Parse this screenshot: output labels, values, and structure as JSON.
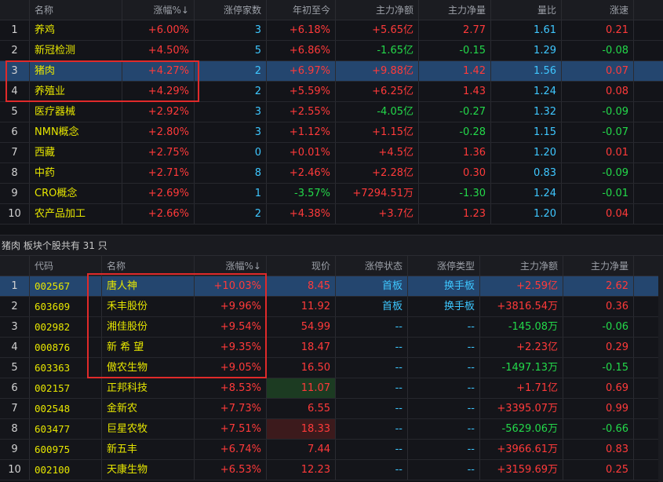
{
  "sectors": {
    "columns": [
      "",
      "名称",
      "涨幅%↓",
      "涨停家数",
      "年初至今",
      "主力净额",
      "主力净量",
      "量比",
      "涨速"
    ],
    "selected_index": 2,
    "rows": [
      {
        "idx": "1",
        "name": "养鸡",
        "change": "+6.00%",
        "limit_up": "3",
        "ytd": "+6.18%",
        "net_amount": "+5.65亿",
        "net_volume": "2.77",
        "vol_ratio": "1.61",
        "speed": "0.21"
      },
      {
        "idx": "2",
        "name": "新冠检测",
        "change": "+4.50%",
        "limit_up": "5",
        "ytd": "+6.86%",
        "net_amount": "-1.65亿",
        "net_volume": "-0.15",
        "vol_ratio": "1.29",
        "speed": "-0.08"
      },
      {
        "idx": "3",
        "name": "猪肉",
        "change": "+4.27%",
        "limit_up": "2",
        "ytd": "+6.97%",
        "net_amount": "+9.88亿",
        "net_volume": "1.42",
        "vol_ratio": "1.56",
        "speed": "0.07"
      },
      {
        "idx": "4",
        "name": "养殖业",
        "change": "+4.29%",
        "limit_up": "2",
        "ytd": "+5.59%",
        "net_amount": "+6.25亿",
        "net_volume": "1.43",
        "vol_ratio": "1.24",
        "speed": "0.08"
      },
      {
        "idx": "5",
        "name": "医疗器械",
        "change": "+2.92%",
        "limit_up": "3",
        "ytd": "+2.55%",
        "net_amount": "-4.05亿",
        "net_volume": "-0.27",
        "vol_ratio": "1.32",
        "speed": "-0.09"
      },
      {
        "idx": "6",
        "name": "NMN概念",
        "change": "+2.80%",
        "limit_up": "3",
        "ytd": "+1.12%",
        "net_amount": "+1.15亿",
        "net_volume": "-0.28",
        "vol_ratio": "1.15",
        "speed": "-0.07"
      },
      {
        "idx": "7",
        "name": "西藏",
        "change": "+2.75%",
        "limit_up": "0",
        "ytd": "+0.01%",
        "net_amount": "+4.5亿",
        "net_volume": "1.36",
        "vol_ratio": "1.20",
        "speed": "0.01"
      },
      {
        "idx": "8",
        "name": "中药",
        "change": "+2.71%",
        "limit_up": "8",
        "ytd": "+2.46%",
        "net_amount": "+2.28亿",
        "net_volume": "0.30",
        "vol_ratio": "0.83",
        "speed": "-0.09"
      },
      {
        "idx": "9",
        "name": "CRO概念",
        "change": "+2.69%",
        "limit_up": "1",
        "ytd": "-3.57%",
        "net_amount": "+7294.51万",
        "net_volume": "-1.30",
        "vol_ratio": "1.24",
        "speed": "-0.01"
      },
      {
        "idx": "10",
        "name": "农产品加工",
        "change": "+2.66%",
        "limit_up": "2",
        "ytd": "+4.38%",
        "net_amount": "+3.7亿",
        "net_volume": "1.23",
        "vol_ratio": "1.20",
        "speed": "0.04"
      }
    ]
  },
  "info_bar": {
    "text": "猪肉  板块个股共有 31 只"
  },
  "stocks": {
    "columns": [
      "",
      "代码",
      "名称",
      "涨幅%↓",
      "现价",
      "涨停状态",
      "涨停类型",
      "主力净额",
      "主力净量"
    ],
    "selected_index": 0,
    "rows": [
      {
        "idx": "1",
        "code": "002567",
        "name": "唐人神",
        "change": "+10.03%",
        "price": "8.45",
        "status": "首板",
        "type": "换手板",
        "net_amount": "+2.59亿",
        "net_volume": "2.62",
        "price_bg": ""
      },
      {
        "idx": "2",
        "code": "603609",
        "name": "禾丰股份",
        "change": "+9.96%",
        "price": "11.92",
        "status": "首板",
        "type": "换手板",
        "net_amount": "+3816.54万",
        "net_volume": "0.36",
        "price_bg": ""
      },
      {
        "idx": "3",
        "code": "002982",
        "name": "湘佳股份",
        "change": "+9.54%",
        "price": "54.99",
        "status": "--",
        "type": "--",
        "net_amount": "-145.08万",
        "net_volume": "-0.06",
        "price_bg": ""
      },
      {
        "idx": "4",
        "code": "000876",
        "name": "新 希 望",
        "change": "+9.35%",
        "price": "18.47",
        "status": "--",
        "type": "--",
        "net_amount": "+2.23亿",
        "net_volume": "0.29",
        "price_bg": ""
      },
      {
        "idx": "5",
        "code": "603363",
        "name": "傲农生物",
        "change": "+9.05%",
        "price": "16.50",
        "status": "--",
        "type": "--",
        "net_amount": "-1497.13万",
        "net_volume": "-0.15",
        "price_bg": ""
      },
      {
        "idx": "6",
        "code": "002157",
        "name": "正邦科技",
        "change": "+8.53%",
        "price": "11.07",
        "status": "--",
        "type": "--",
        "net_amount": "+1.71亿",
        "net_volume": "0.69",
        "price_bg": "green"
      },
      {
        "idx": "7",
        "code": "002548",
        "name": "金新农",
        "change": "+7.73%",
        "price": "6.55",
        "status": "--",
        "type": "--",
        "net_amount": "+3395.07万",
        "net_volume": "0.99",
        "price_bg": ""
      },
      {
        "idx": "8",
        "code": "603477",
        "name": "巨星农牧",
        "change": "+7.51%",
        "price": "18.33",
        "status": "--",
        "type": "--",
        "net_amount": "-5629.06万",
        "net_volume": "-0.66",
        "price_bg": "red"
      },
      {
        "idx": "9",
        "code": "600975",
        "name": "新五丰",
        "change": "+6.74%",
        "price": "7.44",
        "status": "--",
        "type": "--",
        "net_amount": "+3966.61万",
        "net_volume": "0.83",
        "price_bg": ""
      },
      {
        "idx": "10",
        "code": "002100",
        "name": "天康生物",
        "change": "+6.53%",
        "price": "12.23",
        "status": "--",
        "type": "--",
        "net_amount": "+3159.69万",
        "net_volume": "0.25",
        "price_bg": ""
      }
    ]
  },
  "colors": {
    "up": "#ff3a3a",
    "down": "#23d94a",
    "name": "#e6e600",
    "status": "#3ec7ff",
    "selected_row": "#24466f",
    "highlight_box": "#e02a2a"
  }
}
